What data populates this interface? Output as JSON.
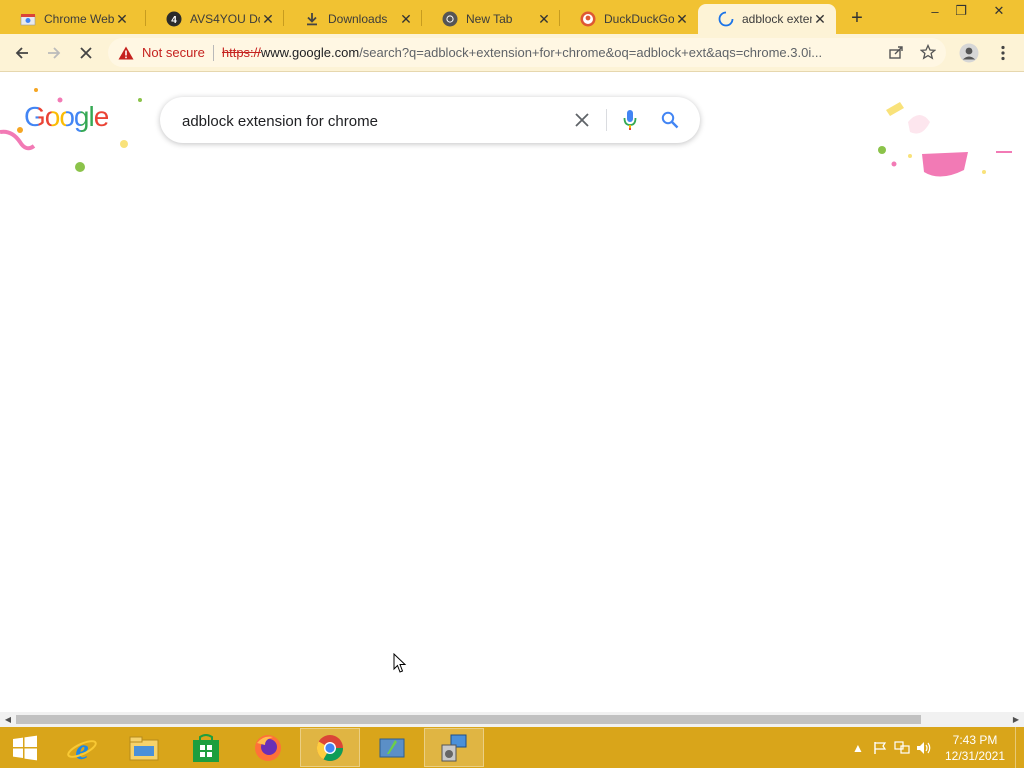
{
  "browser": {
    "tabs": [
      {
        "title": "Chrome Web",
        "favicon": "chrome-webstore-icon",
        "active": false
      },
      {
        "title": "AVS4YOU Dov",
        "favicon": "avs4you-icon",
        "active": false
      },
      {
        "title": "Downloads",
        "favicon": "download-icon",
        "active": false
      },
      {
        "title": "New Tab",
        "favicon": "chrome-icon",
        "active": false
      },
      {
        "title": "DuckDuckGo",
        "favicon": "duckduckgo-icon",
        "active": false
      },
      {
        "title": "adblock exten",
        "favicon": "loading-spinner-icon",
        "active": true
      }
    ],
    "new_tab_label": "+",
    "window_controls": {
      "minimize": "–",
      "restore": "❐",
      "close": "✕"
    },
    "security_label": "Not secure",
    "url_scheme": "https://",
    "url_host": "www.google.com",
    "url_rest": "/search?q=adblock+extension+for+chrome&oq=adblock+ext&aqs=chrome.3.0i..."
  },
  "page": {
    "logo_text": "Google",
    "search_value": "adblock extension for chrome"
  },
  "taskbar": {
    "apps": [
      {
        "name": "start-button"
      },
      {
        "name": "internet-explorer-icon"
      },
      {
        "name": "file-explorer-icon"
      },
      {
        "name": "store-icon"
      },
      {
        "name": "firefox-icon"
      },
      {
        "name": "chrome-icon"
      },
      {
        "name": "app-icon"
      },
      {
        "name": "installer-icon"
      }
    ],
    "time": "7:43 PM",
    "date": "12/31/2021"
  },
  "colors": {
    "tabstrip": "#f1c232",
    "toolbar": "#fdf3d6",
    "taskbar": "#d9a51a",
    "not_secure": "#c5221f"
  }
}
